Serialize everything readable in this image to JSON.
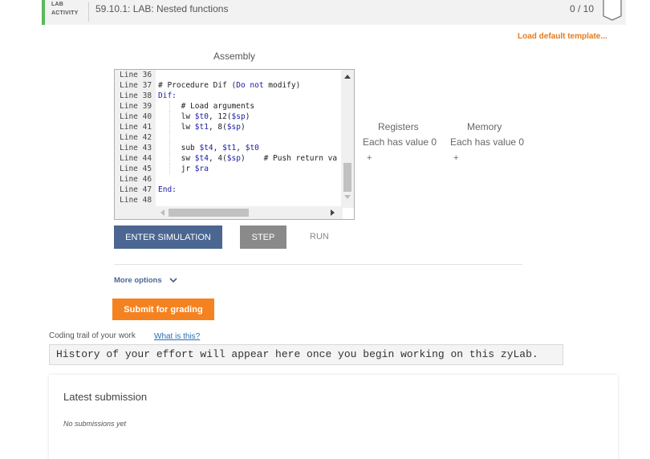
{
  "header": {
    "tag_line1": "LAB",
    "tag_line2": "ACTIVITY",
    "title": "59.10.1: LAB: Nested functions",
    "score": "0 / 10"
  },
  "load_template": "Load default template...",
  "assembly_title": "Assembly",
  "code": [
    {
      "ln": "Line 36",
      "segments": []
    },
    {
      "ln": "Line 37",
      "segments": [
        {
          "t": "# Procedure Dif (",
          "c": ""
        },
        {
          "t": "Do not",
          "c": "kw"
        },
        {
          "t": " modify)",
          "c": ""
        }
      ]
    },
    {
      "ln": "Line 38",
      "segments": [
        {
          "t": "Dif:",
          "c": "lbl"
        }
      ]
    },
    {
      "ln": "Line 39",
      "segments": [
        {
          "t": "     # Load arguments",
          "c": ""
        }
      ]
    },
    {
      "ln": "Line 40",
      "segments": [
        {
          "t": "     lw ",
          "c": ""
        },
        {
          "t": "$t0",
          "c": "reg"
        },
        {
          "t": ", 12(",
          "c": ""
        },
        {
          "t": "$sp",
          "c": "reg"
        },
        {
          "t": ")",
          "c": ""
        }
      ]
    },
    {
      "ln": "Line 41",
      "segments": [
        {
          "t": "     lw ",
          "c": ""
        },
        {
          "t": "$t1",
          "c": "reg"
        },
        {
          "t": ", 8(",
          "c": ""
        },
        {
          "t": "$sp",
          "c": "reg"
        },
        {
          "t": ")",
          "c": ""
        }
      ]
    },
    {
      "ln": "Line 42",
      "segments": []
    },
    {
      "ln": "Line 43",
      "segments": [
        {
          "t": "     sub ",
          "c": ""
        },
        {
          "t": "$t4",
          "c": "reg"
        },
        {
          "t": ", ",
          "c": ""
        },
        {
          "t": "$t1",
          "c": "reg"
        },
        {
          "t": ", ",
          "c": ""
        },
        {
          "t": "$t0",
          "c": "reg"
        }
      ]
    },
    {
      "ln": "Line 44",
      "segments": [
        {
          "t": "     sw ",
          "c": ""
        },
        {
          "t": "$t4",
          "c": "reg"
        },
        {
          "t": ", 4(",
          "c": ""
        },
        {
          "t": "$sp",
          "c": "reg"
        },
        {
          "t": ")    # Push return va",
          "c": ""
        }
      ]
    },
    {
      "ln": "Line 45",
      "segments": [
        {
          "t": "     jr ",
          "c": ""
        },
        {
          "t": "$ra",
          "c": "reg"
        }
      ]
    },
    {
      "ln": "Line 46",
      "segments": []
    },
    {
      "ln": "Line 47",
      "segments": [
        {
          "t": "End:",
          "c": "lbl"
        }
      ]
    },
    {
      "ln": "Line 48",
      "segments": []
    }
  ],
  "registers": {
    "title": "Registers",
    "subtitle": "Each has value 0",
    "add": "+"
  },
  "memory": {
    "title": "Memory",
    "subtitle": "Each has value 0",
    "add": "+"
  },
  "buttons": {
    "enter": "ENTER SIMULATION",
    "step": "STEP",
    "run": "RUN",
    "submit": "Submit for grading"
  },
  "more_options": "More options",
  "trail": {
    "label": "Coding trail of your work",
    "link": "What is this?",
    "text": "History of your effort will appear here once you begin working on this zyLab."
  },
  "submission": {
    "title": "Latest submission",
    "none": "No submissions yet"
  },
  "colors": {
    "accent_green": "#5cb85c",
    "accent_orange": "#f58220",
    "button_blue": "#4a6691",
    "link_orange": "#e37c1c"
  }
}
